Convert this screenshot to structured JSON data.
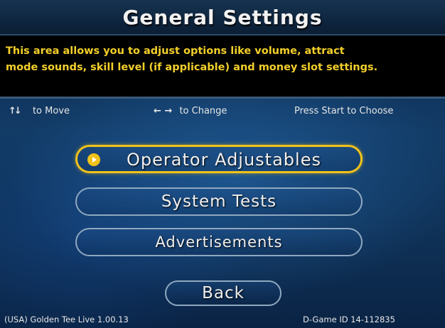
{
  "header": {
    "title": "General Settings"
  },
  "description": {
    "line1": "This area allows you to adjust options like volume, attract",
    "line2": "mode sounds, skill level (if applicable) and money slot settings."
  },
  "hints": {
    "move_icon": "up-down-arrows-icon",
    "move_glyph": "↑↓",
    "move_label": "to Move",
    "change_icon": "left-right-arrows-icon",
    "change_glyph": "← →",
    "change_label": "to Change",
    "choose_label": "Press Start to Choose"
  },
  "menu": {
    "selected_index": 0,
    "items": [
      {
        "label": "Operator Adjustables"
      },
      {
        "label": "System Tests"
      },
      {
        "label": "Advertisements"
      }
    ],
    "back_label": "Back"
  },
  "footer": {
    "version": "(USA) Golden Tee Live 1.00.13",
    "game_id": "D-Game ID 14-112835"
  },
  "colors": {
    "description_text": "#f3cf2a",
    "selection_outline": "#f0c21a",
    "button_outline": "#8fa8c0"
  }
}
